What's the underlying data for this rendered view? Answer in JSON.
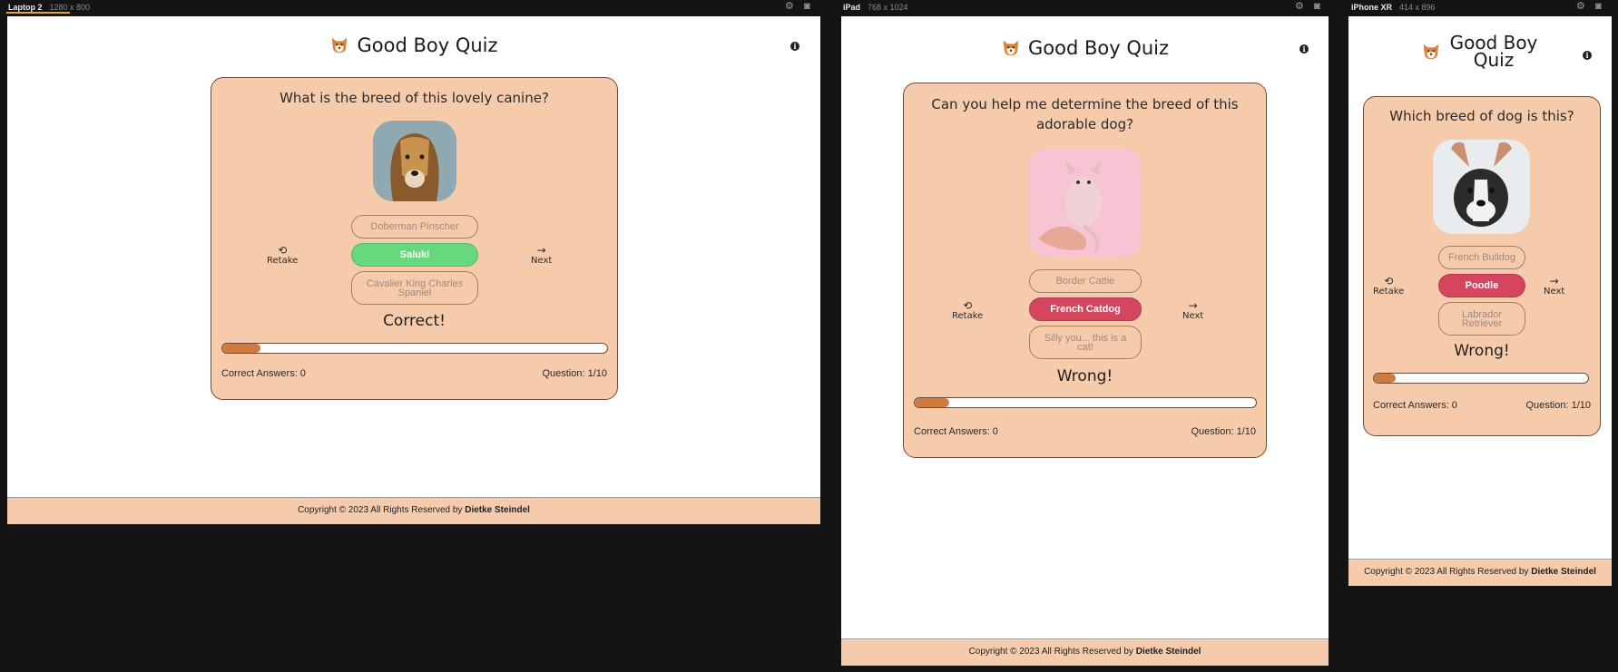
{
  "app_title": "Good Boy Quiz",
  "footer": {
    "text": "Copyright © 2023 All Rights Reserved by",
    "author": "Dietke Steindel"
  },
  "controls": {
    "retake": "Retake",
    "next": "Next"
  },
  "stats": {
    "correct_label": "Correct Answers: 0",
    "question_label": "Question: 1/10"
  },
  "progress_fraction": 0.1,
  "icons": {
    "logo": "shiba-dog-icon",
    "info": "info-icon",
    "retake": "repeat-icon",
    "next": "arrow-right-icon",
    "settings": "gear-icon",
    "screenshot": "camera-icon"
  },
  "colors": {
    "card": "#f6cbab",
    "correct": "#67d87c",
    "wrong": "#d3465e",
    "progress": "#cf7a3f"
  },
  "devices": [
    {
      "name": "Laptop 2",
      "size": "1280 x 800",
      "question": "What is the breed of this lovely canine?",
      "answers": [
        "Doberman Pinscher",
        "Saluki",
        "Cavalier King Charles Spaniel"
      ],
      "selected": "Saluki",
      "result": "Correct!"
    },
    {
      "name": "iPad",
      "size": "768 x 1024",
      "question": "Can you help me determine the breed of this adorable dog?",
      "answers": [
        "Border Cattie",
        "French Catdog",
        "Silly you... this is a cat!"
      ],
      "selected": "French Catdog",
      "result": "Wrong!"
    },
    {
      "name": "iPhone XR",
      "size": "414 x 896",
      "question": "Which breed of dog is this?",
      "answers": [
        "French Bulldog",
        "Poodle",
        "Labrador Retriever"
      ],
      "selected": "Poodle",
      "result": "Wrong!"
    }
  ]
}
